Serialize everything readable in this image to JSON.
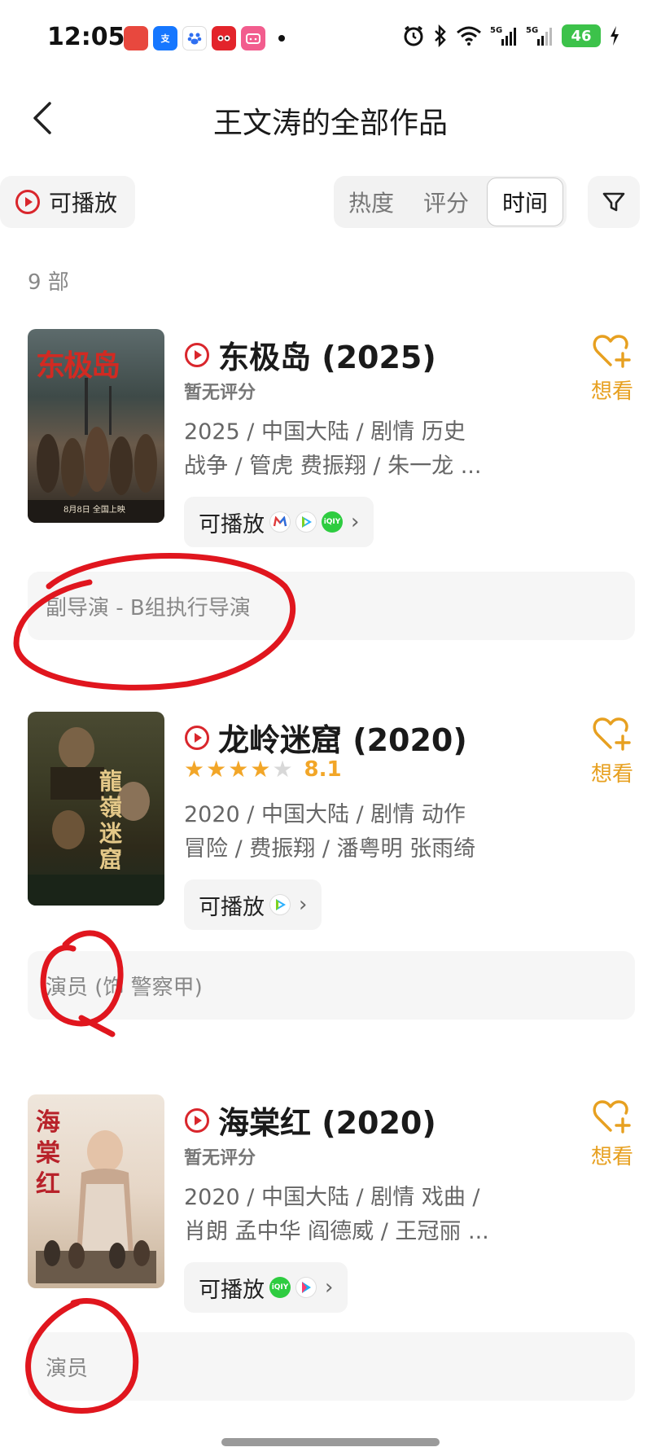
{
  "status_bar": {
    "time": "12:05",
    "apps": [
      {
        "name": "app-1",
        "color": "#e8483e"
      },
      {
        "name": "alipay",
        "color": "#1677ff"
      },
      {
        "name": "baidu",
        "color": "#2f6ff1"
      },
      {
        "name": "tmall",
        "color": "#e3242b"
      },
      {
        "name": "bilibili",
        "color": "#f25d8e"
      }
    ],
    "battery": "46"
  },
  "header": {
    "title": "王文涛的全部作品"
  },
  "filters": {
    "playable_label": "可播放",
    "sort_tabs": [
      {
        "label": "热度",
        "active": false
      },
      {
        "label": "评分",
        "active": false
      },
      {
        "label": "时间",
        "active": true
      }
    ]
  },
  "count_label": "9 部",
  "colors": {
    "accent_red": "#d9262c",
    "star_gold": "#f2a628",
    "want_orange": "#e7a020",
    "annotation_red": "#e0161e"
  },
  "movies": [
    {
      "title": "东极岛 (2025)",
      "rating_text": "暂无评分",
      "meta_line1": "2025 / 中国大陆 / 剧情 历史",
      "meta_line2": "战争 / 管虎 费振翔 / 朱一龙 ...",
      "play_label": "可播放",
      "platforms": [
        "mgtv-icon",
        "tencent-video-icon",
        "iqiyi-icon"
      ],
      "want_label": "想看",
      "role": "副导演 - B组执行导演",
      "poster_text": "东极岛",
      "poster_caption": "8月8日 全国上映"
    },
    {
      "title": "龙岭迷窟 (2020)",
      "rating_stars": 4,
      "score": "8.1",
      "meta_line1": "2020 / 中国大陆 / 剧情 动作",
      "meta_line2": "冒险 / 费振翔 / 潘粤明 张雨绮",
      "play_label": "可播放",
      "platforms": [
        "tencent-video-icon"
      ],
      "want_label": "想看",
      "role": "演员 (饰 警察甲)",
      "poster_text": "龍嶺迷窟"
    },
    {
      "title": "海棠红 (2020)",
      "rating_text": "暂无评分",
      "meta_line1": "2020 / 中国大陆 / 剧情 戏曲 /",
      "meta_line2": "肖朗 孟中华 阎德威 / 王冠丽 ...",
      "play_label": "可播放",
      "platforms": [
        "iqiyi-icon",
        "youku-icon"
      ],
      "want_label": "想看",
      "role": "演员",
      "poster_text": "海棠红"
    }
  ]
}
